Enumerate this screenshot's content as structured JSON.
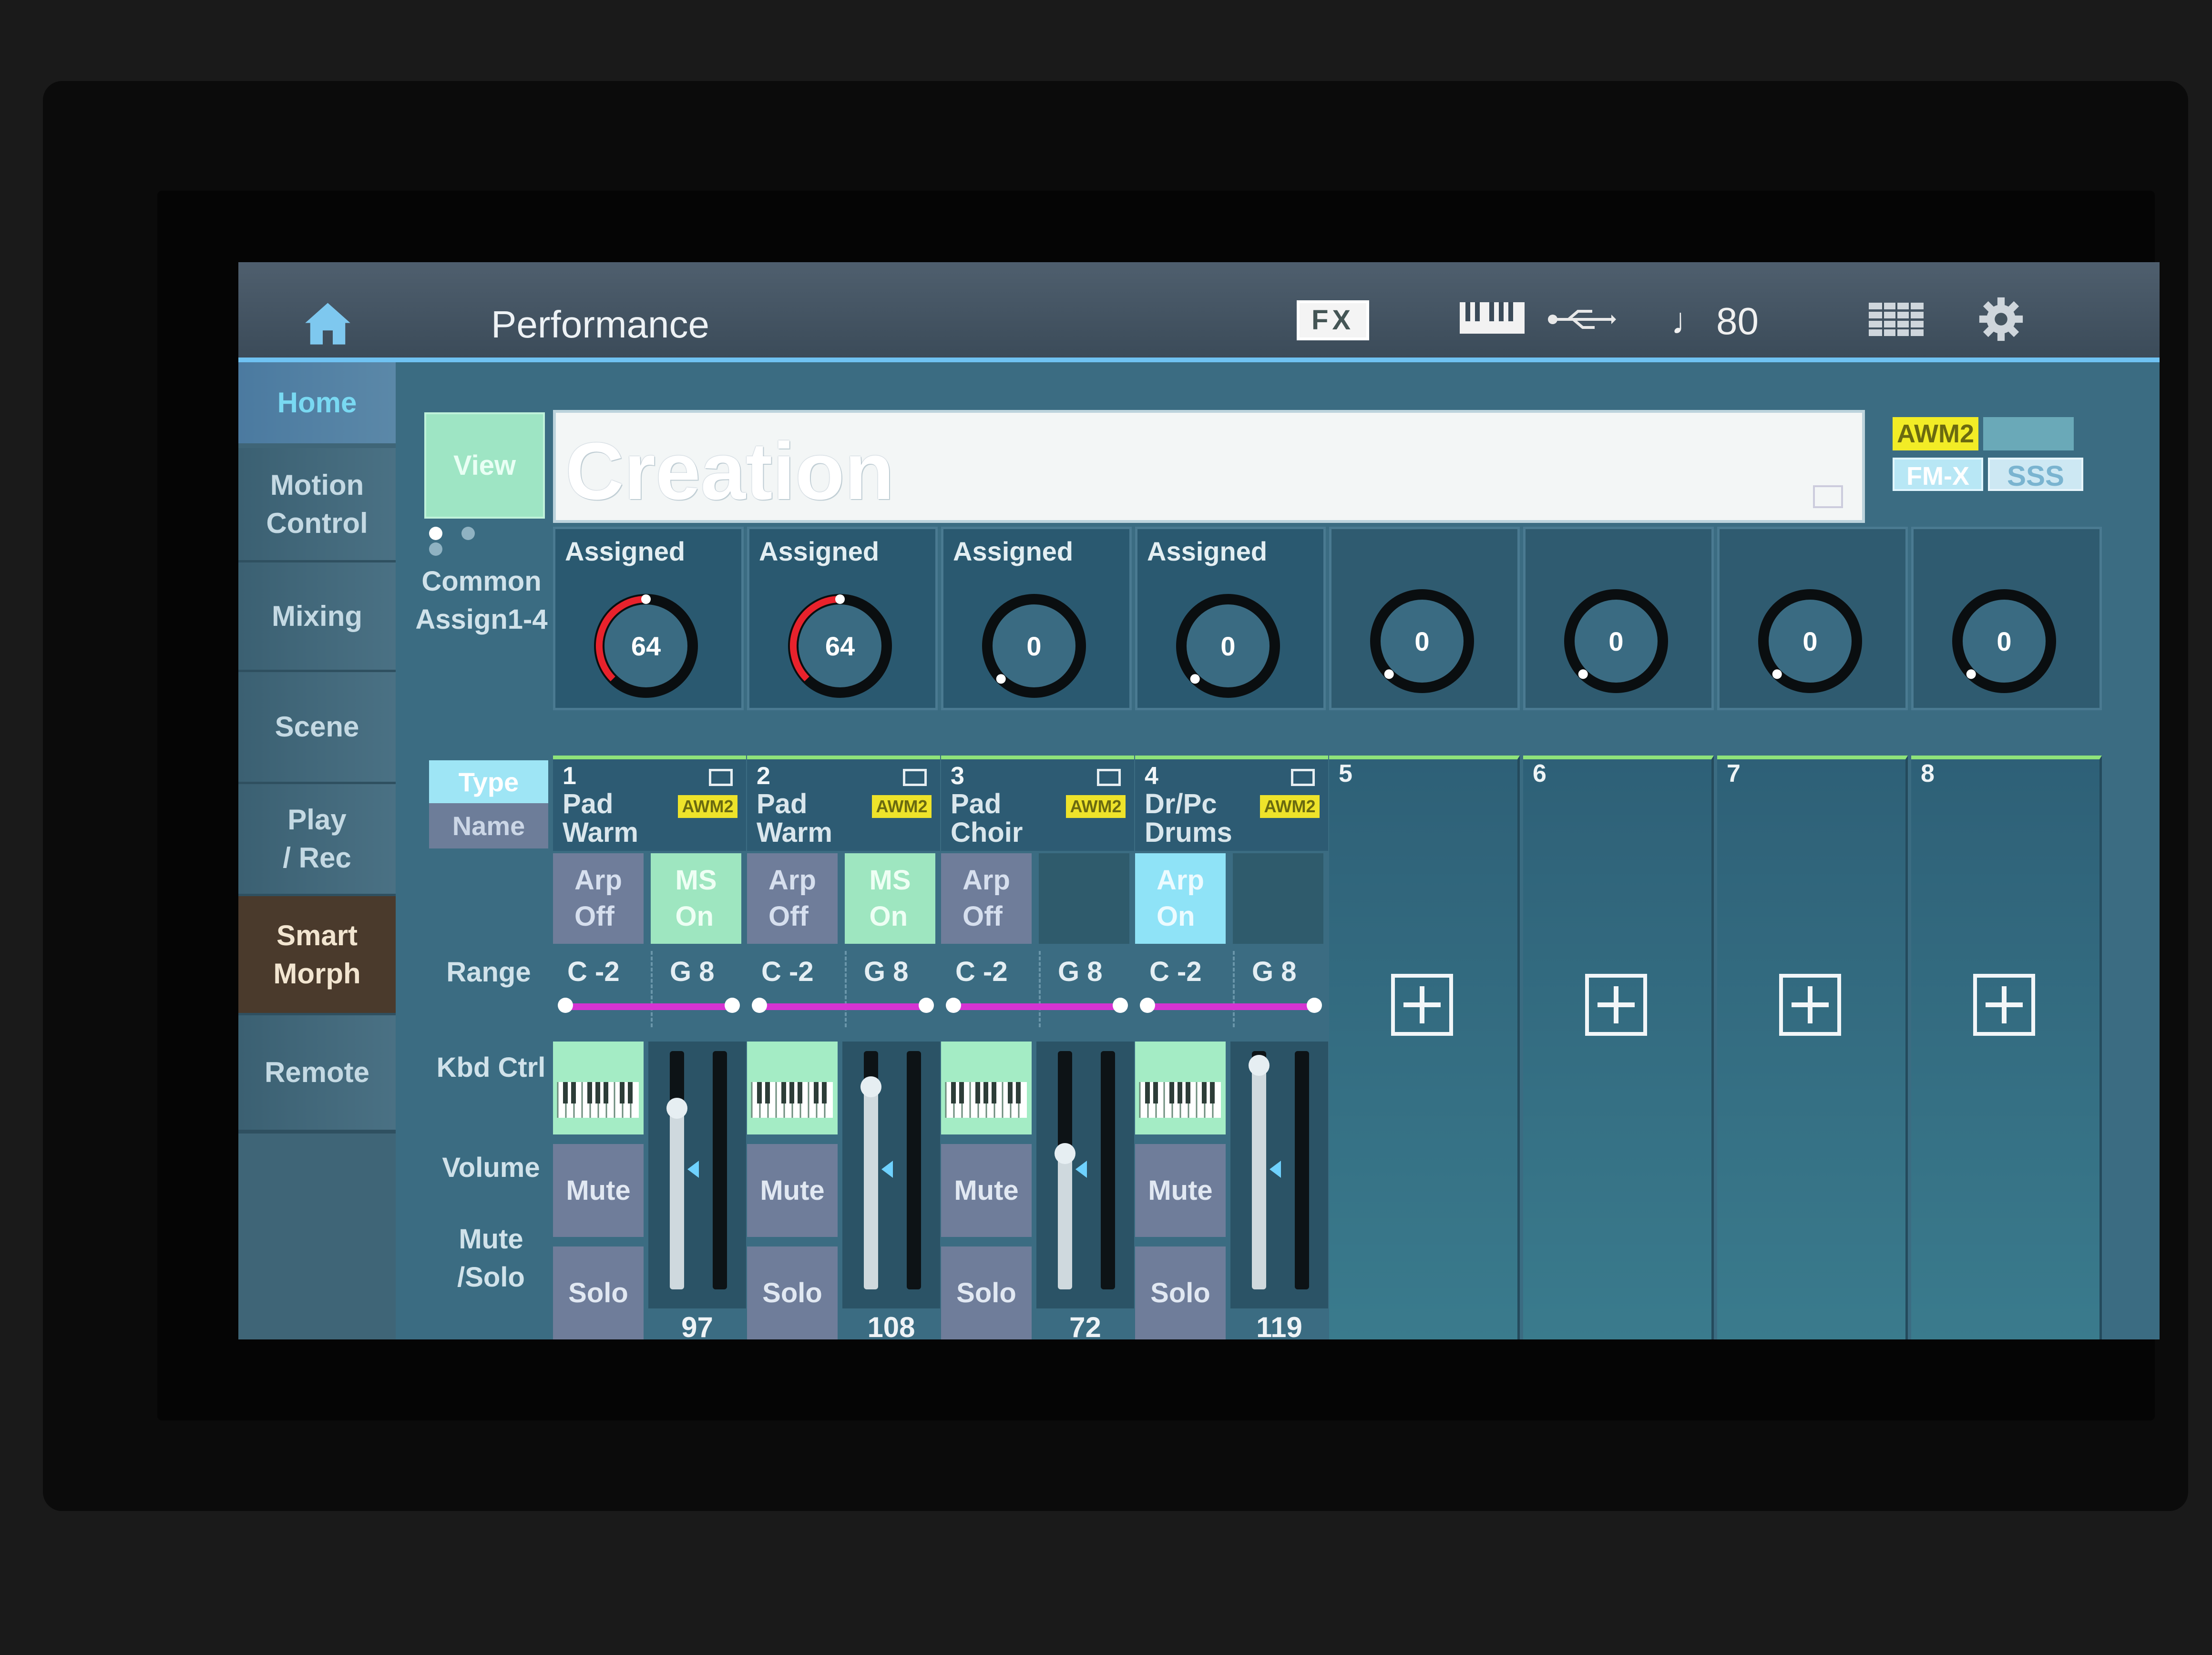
{
  "titlebar": {
    "title": "Performance",
    "fx_label": "FX",
    "tempo_note": "♩",
    "tempo_value": "80"
  },
  "nav": {
    "items": [
      {
        "label": "Home"
      },
      {
        "label": "Motion\nControl"
      },
      {
        "label": "Mixing"
      },
      {
        "label": "Scene"
      },
      {
        "label": "Play\n/ Rec"
      },
      {
        "label": "Smart\nMorph"
      },
      {
        "label": "Remote"
      }
    ]
  },
  "view_button": "View",
  "performance_name": "Creation",
  "badges": {
    "awm": "AWM2",
    "fm": "FM-X",
    "sss": "SSS"
  },
  "row_labels": {
    "common": "Common\nAssign1-4",
    "type": "Type",
    "name": "Name",
    "range": "Range",
    "kbd_ctrl": "Kbd Ctrl",
    "volume": "Volume",
    "mute_solo": "Mute\n/Solo"
  },
  "knobs": [
    {
      "label": "Assigned",
      "value": "64",
      "level": 0.5
    },
    {
      "label": "Assigned",
      "value": "64",
      "level": 0.5
    },
    {
      "label": "Assigned",
      "value": "0",
      "level": 0
    },
    {
      "label": "Assigned",
      "value": "0",
      "level": 0
    },
    {
      "label": "",
      "value": "0",
      "level": 0
    },
    {
      "label": "",
      "value": "0",
      "level": 0
    },
    {
      "label": "",
      "value": "0",
      "level": 0
    },
    {
      "label": "",
      "value": "0",
      "level": 0
    }
  ],
  "parts": [
    {
      "num": "1",
      "line1": "Pad",
      "line2": "Warm",
      "awm": "AWM2",
      "arp": "Arp\nOff",
      "arp_on": false,
      "ms": "MS\nOn",
      "range_low": "C -2",
      "range_high": "G 8",
      "mute": "Mute",
      "solo": "Solo",
      "volume": "97",
      "volume_level": 0.76
    },
    {
      "num": "2",
      "line1": "Pad",
      "line2": "Warm",
      "awm": "AWM2",
      "arp": "Arp\nOff",
      "arp_on": false,
      "ms": "MS\nOn",
      "range_low": "C -2",
      "range_high": "G 8",
      "mute": "Mute",
      "solo": "Solo",
      "volume": "108",
      "volume_level": 0.85
    },
    {
      "num": "3",
      "line1": "Pad",
      "line2": "Choir",
      "awm": "AWM2",
      "arp": "Arp\nOff",
      "arp_on": false,
      "ms": "",
      "range_low": "C -2",
      "range_high": "G 8",
      "mute": "Mute",
      "solo": "Solo",
      "volume": "72",
      "volume_level": 0.57
    },
    {
      "num": "4",
      "line1": "Dr/Pc",
      "line2": "Drums",
      "awm": "AWM2",
      "arp": "Arp\nOn",
      "arp_on": true,
      "ms": "",
      "range_low": "C -2",
      "range_high": "G 8",
      "mute": "Mute",
      "solo": "Solo",
      "volume": "119",
      "volume_level": 0.94
    }
  ],
  "empty_parts": [
    "5",
    "6",
    "7",
    "8"
  ],
  "colors": {
    "accent": "#6fc2f2",
    "awm": "#f2ec26",
    "range": "#d633d2",
    "knob_red": "#e8222c",
    "ms_on": "#9ee6c0"
  }
}
